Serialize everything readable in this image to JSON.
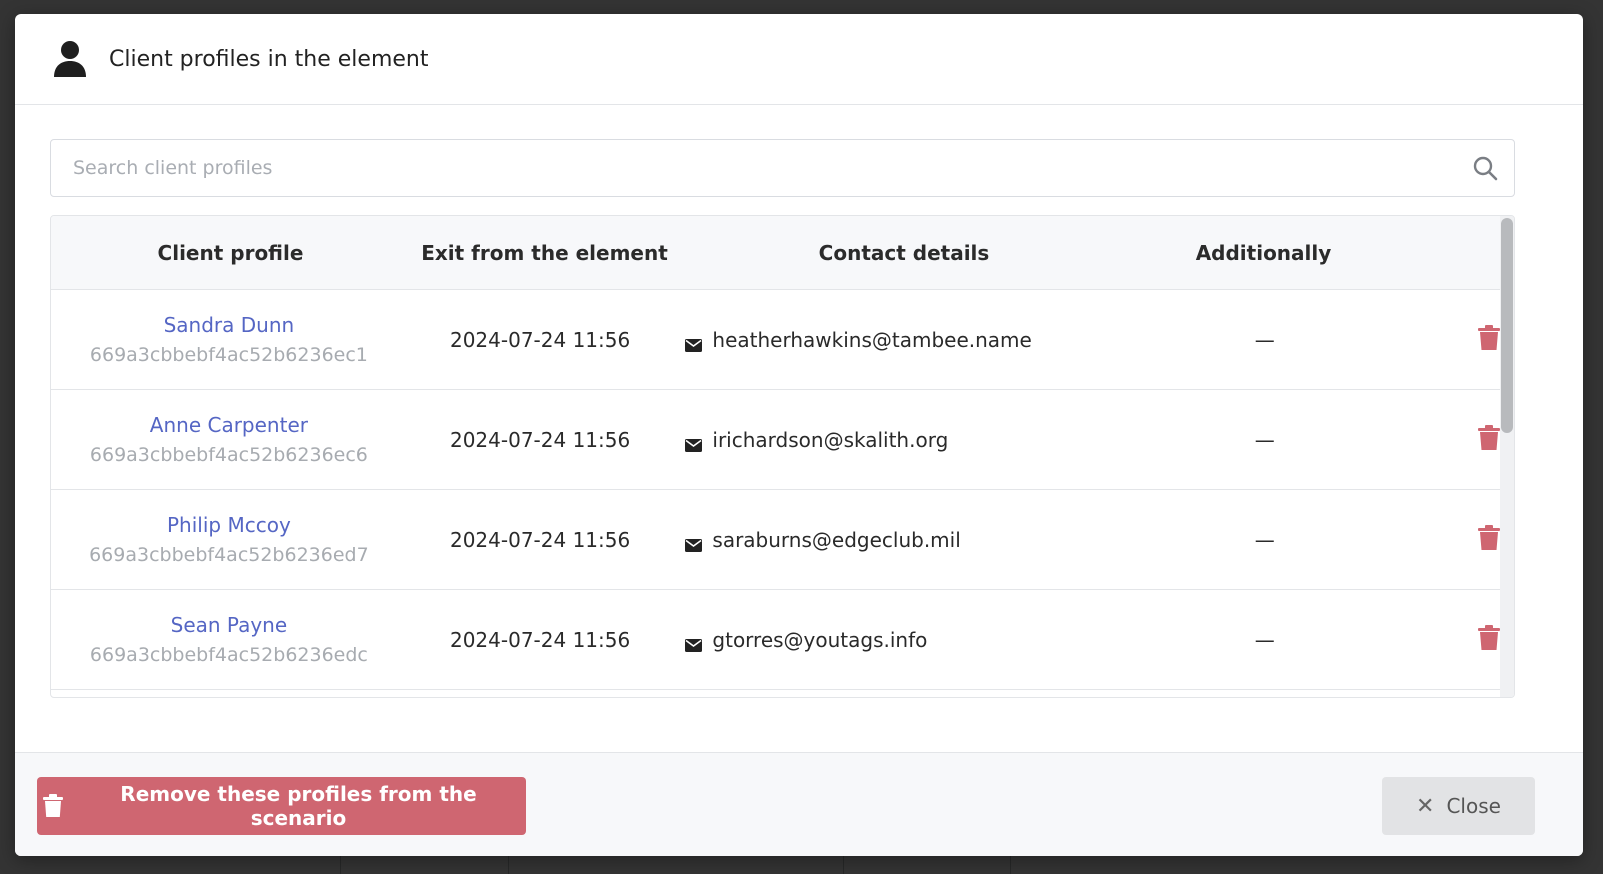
{
  "modal": {
    "title": "Client profiles in the element",
    "title_icon": "user-icon"
  },
  "search": {
    "placeholder": "Search client profiles",
    "value": "",
    "icon": "search-icon"
  },
  "table": {
    "columns": [
      "Client profile",
      "Exit from the element",
      "Contact details",
      "Additionally"
    ],
    "rows": [
      {
        "name": "Sandra Dunn",
        "id": "669a3cbbebf4ac52b6236ec1",
        "exit": "2024-07-24 11:56",
        "email": "heatherhawkins@tambee.name",
        "additional": "—"
      },
      {
        "name": "Anne Carpenter",
        "id": "669a3cbbebf4ac52b6236ec6",
        "exit": "2024-07-24 11:56",
        "email": "irichardson@skalith.org",
        "additional": "—"
      },
      {
        "name": "Philip Mccoy",
        "id": "669a3cbbebf4ac52b6236ed7",
        "exit": "2024-07-24 11:56",
        "email": "saraburns@edgeclub.mil",
        "additional": "—"
      },
      {
        "name": "Sean Payne",
        "id": "669a3cbbebf4ac52b6236edc",
        "exit": "2024-07-24 11:56",
        "email": "gtorres@youtags.info",
        "additional": "—"
      }
    ],
    "row_action_icon": "trash-icon"
  },
  "footer": {
    "remove_label": "Remove these profiles from the scenario",
    "close_label": "Close"
  },
  "colors": {
    "accent_link": "#5566c4",
    "danger": "#cf6671",
    "muted_text": "#a7abb0"
  }
}
